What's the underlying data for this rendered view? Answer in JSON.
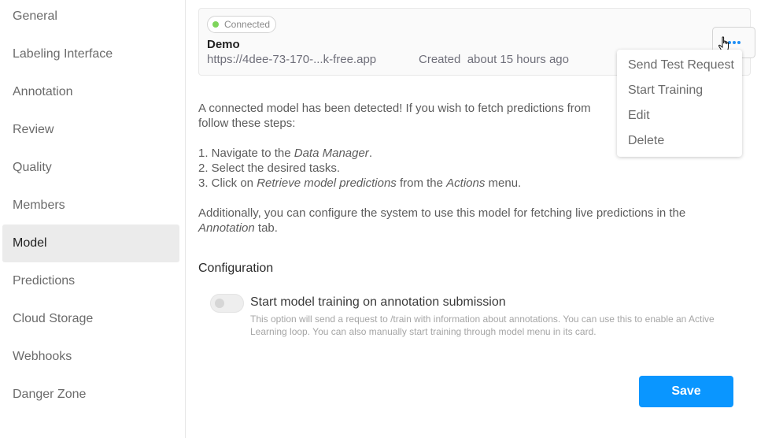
{
  "sidebar": {
    "items": [
      {
        "label": "General"
      },
      {
        "label": "Labeling Interface"
      },
      {
        "label": "Annotation"
      },
      {
        "label": "Review"
      },
      {
        "label": "Quality"
      },
      {
        "label": "Members"
      },
      {
        "label": "Model",
        "active": true
      },
      {
        "label": "Predictions"
      },
      {
        "label": "Cloud Storage"
      },
      {
        "label": "Webhooks"
      },
      {
        "label": "Danger Zone"
      }
    ]
  },
  "model_card": {
    "status": "Connected",
    "status_color": "#7ed55b",
    "name": "Demo",
    "url": "https://4dee-73-170-...k-free.app",
    "created_label": "Created",
    "created_value": "about 15 hours ago",
    "more_icon": "ellipsis-icon"
  },
  "menu": {
    "items": [
      {
        "label": "Send Test Request"
      },
      {
        "label": "Start Training"
      },
      {
        "label": "Edit"
      },
      {
        "label": "Delete"
      }
    ]
  },
  "info": {
    "intro_line1": "A connected model has been detected! If you wish to fetch predictions from",
    "intro_line2": "follow these steps:",
    "step1_prefix": "1. Navigate to the ",
    "step1_em": "Data Manager",
    "step1_suffix": ".",
    "step2": "2. Select the desired tasks.",
    "step3_prefix": "3. Click on ",
    "step3_em1": "Retrieve model predictions",
    "step3_mid": " from the ",
    "step3_em2": "Actions",
    "step3_suffix": " menu.",
    "additional_line1": "Additionally, you can configure the system to use this model for fetching live predictions in the",
    "additional_em": "Annotation",
    "additional_suffix": " tab."
  },
  "configuration": {
    "title": "Configuration",
    "toggle_label": "Start model training on annotation submission",
    "toggle_on": false,
    "toggle_help": "This option will send a request to /train with information about annotations. You can use this to enable an Active Learning loop. You can also manually start training through model menu in its card."
  },
  "actions": {
    "save_label": "Save",
    "save_color": "#0a96ff"
  }
}
